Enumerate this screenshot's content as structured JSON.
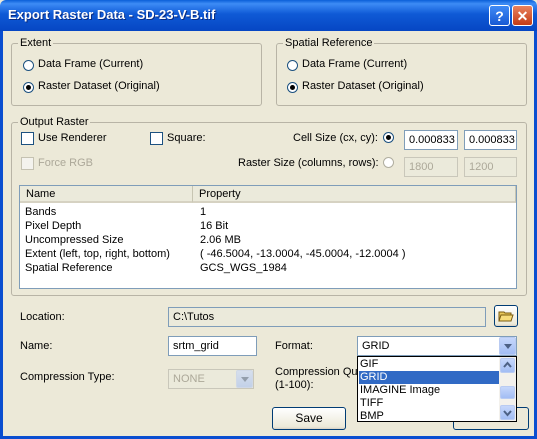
{
  "window": {
    "title": "Export Raster Data - SD-23-V-B.tif"
  },
  "extent": {
    "legend": "Extent",
    "opt1": "Data Frame (Current)",
    "opt2": "Raster Dataset (Original)"
  },
  "spatial_reference": {
    "legend": "Spatial Reference",
    "opt1": "Data Frame (Current)",
    "opt2": "Raster Dataset (Original)"
  },
  "output_raster": {
    "legend": "Output Raster",
    "use_renderer": "Use Renderer",
    "square": "Square:",
    "force_rgb": "Force RGB",
    "cell_size_label": "Cell Size (cx, cy):",
    "cell_cx": "0.000833",
    "cell_cy": "0.000833",
    "raster_size_label": "Raster Size (columns, rows):",
    "cols": "1800",
    "rows": "1200"
  },
  "table": {
    "headers": [
      "Name",
      "Property"
    ],
    "rows": [
      [
        "Bands",
        "1"
      ],
      [
        "Pixel Depth",
        "16 Bit"
      ],
      [
        "Uncompressed Size",
        "2.06 MB"
      ],
      [
        "Extent (left, top, right, bottom)",
        "( -46.5004, -13.0004, -45.0004, -12.0004 )"
      ],
      [
        "Spatial Reference",
        "GCS_WGS_1984"
      ]
    ]
  },
  "location": {
    "label": "Location:",
    "value": "C:\\Tutos"
  },
  "name": {
    "label": "Name:",
    "value": "srtm_grid"
  },
  "format": {
    "label": "Format:",
    "value": "GRID",
    "options": [
      "GIF",
      "GRID",
      "IMAGINE Image",
      "TIFF",
      "BMP"
    ],
    "selected_index": 1
  },
  "compression": {
    "type_label": "Compression Type:",
    "type_value": "NONE",
    "quality_label": "Compression Qua",
    "quality_range": "(1-100):"
  },
  "buttons": {
    "save": "Save"
  }
}
